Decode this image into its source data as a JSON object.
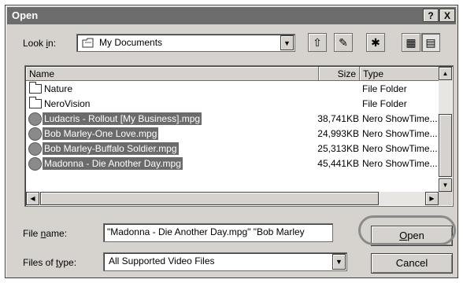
{
  "window": {
    "title": "Open",
    "help_label": "?",
    "close_label": "X"
  },
  "lookin": {
    "label_pre": "Look ",
    "label_u": "i",
    "label_post": "n:",
    "value": "My Documents",
    "icon": "documents-folder-icon"
  },
  "toolbar": {
    "buttons": [
      {
        "name": "up-one-level",
        "glyph": "⇧"
      },
      {
        "name": "search-web",
        "glyph": "✎"
      },
      {
        "name": "create-new-folder",
        "glyph": "✱"
      },
      {
        "name": "view-list",
        "glyph": "▦"
      },
      {
        "name": "view-details",
        "glyph": "▤"
      }
    ]
  },
  "list": {
    "headers": {
      "name": "Name",
      "size": "Size",
      "type": "Type"
    },
    "rows": [
      {
        "name": "Nature",
        "size": "",
        "type": "File Folder",
        "kind": "folder",
        "selected": false
      },
      {
        "name": "NeroVision",
        "size": "",
        "type": "File Folder",
        "kind": "folder",
        "selected": false
      },
      {
        "name": "Ludacris - Rollout [My Business].mpg",
        "size": "38,741KB",
        "type": "Nero ShowTime...",
        "kind": "video",
        "selected": true
      },
      {
        "name": "Bob Marley-One Love.mpg",
        "size": "24,993KB",
        "type": "Nero ShowTime...",
        "kind": "video",
        "selected": true
      },
      {
        "name": "Bob Marley-Buffalo Soldier.mpg",
        "size": "25,313KB",
        "type": "Nero ShowTime...",
        "kind": "video",
        "selected": true
      },
      {
        "name": "Madonna - Die Another Day.mpg",
        "size": "45,441KB",
        "type": "Nero ShowTime...",
        "kind": "video",
        "selected": true
      }
    ]
  },
  "filename": {
    "label_pre": "File ",
    "label_u": "n",
    "label_post": "ame:",
    "value": "\"Madonna - Die Another Day.mpg\" \"Bob Marley"
  },
  "filetype": {
    "label_pre": "Files of ",
    "label_u": "t",
    "label_post": "ype:",
    "value": "All Supported Video Files"
  },
  "buttons": {
    "open_u": "O",
    "open_rest": "pen",
    "cancel": "Cancel"
  }
}
